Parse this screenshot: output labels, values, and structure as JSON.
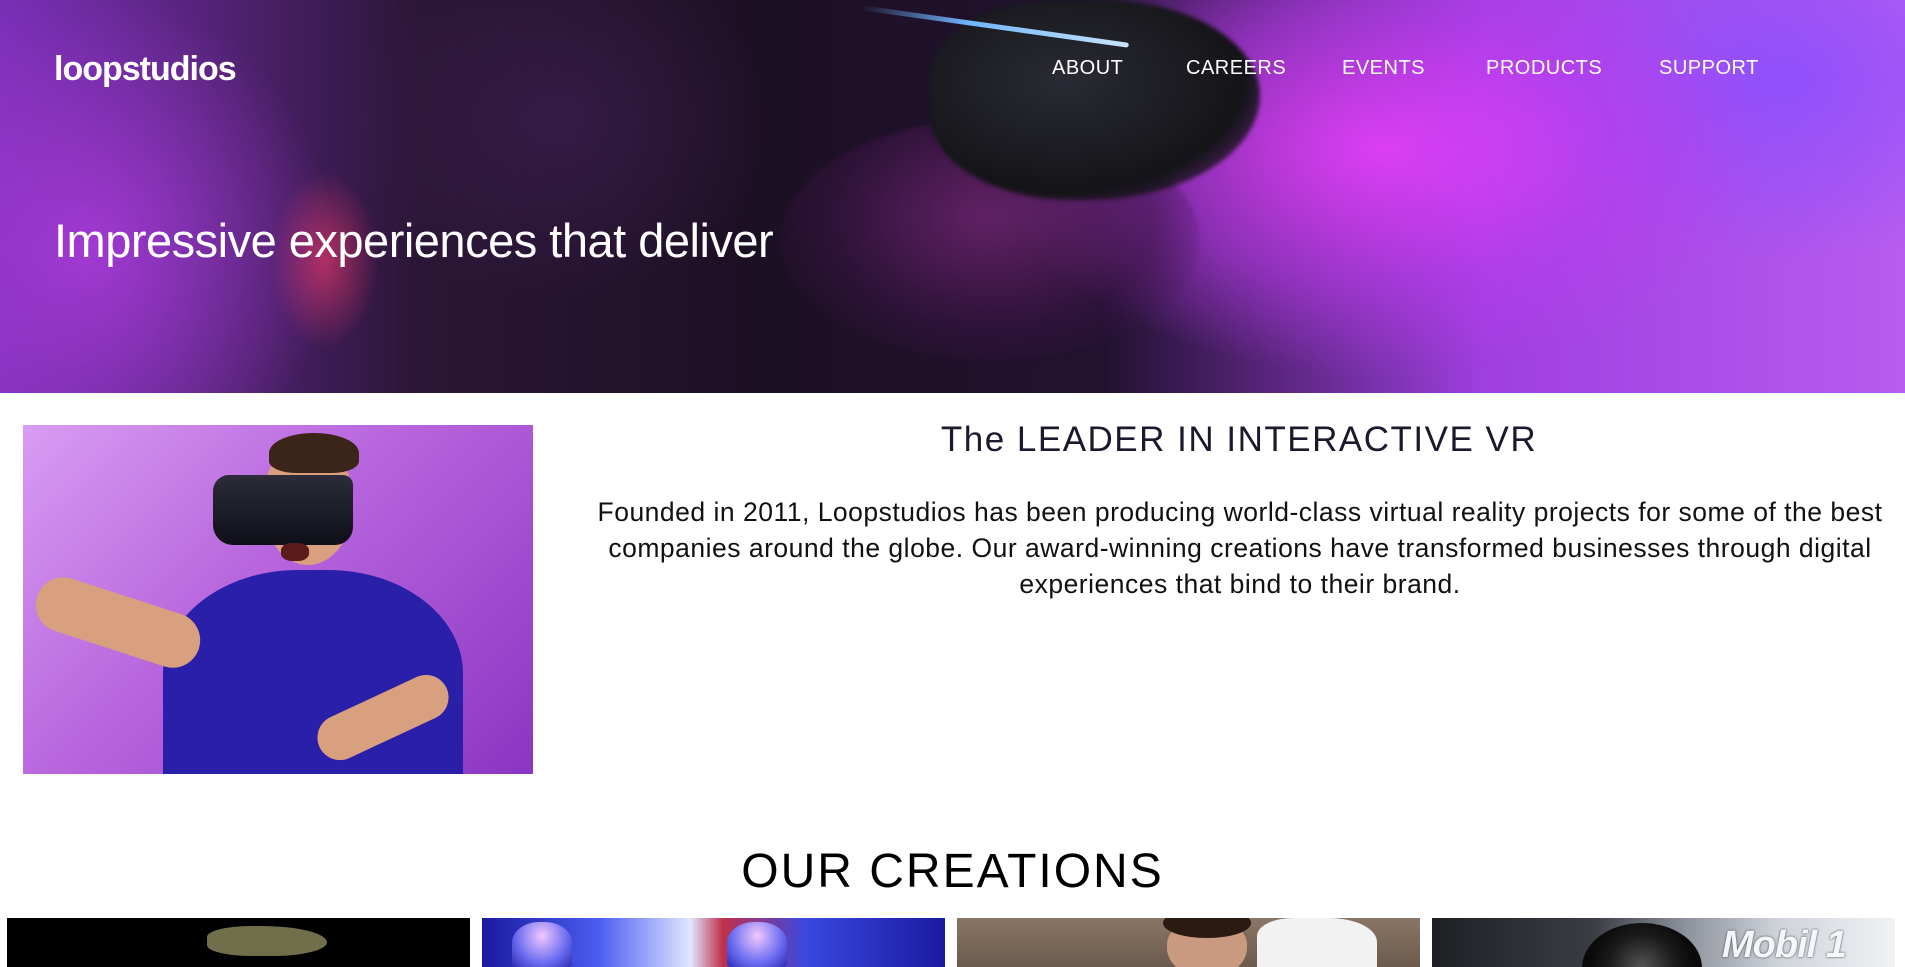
{
  "header": {
    "logo": "loopstudios",
    "nav": [
      {
        "label": "ABOUT"
      },
      {
        "label": "CAREERS"
      },
      {
        "label": "EVENTS"
      },
      {
        "label": "PRODUCTS"
      },
      {
        "label": "SUPPORT"
      }
    ]
  },
  "hero": {
    "headline": "Impressive experiences that deliver"
  },
  "intro": {
    "title": "The LEADER IN INTERACTIVE VR",
    "body": "Founded in 2011, Loopstudios has been producing world-class virtual reality projects for some of the best companies around the globe. Our award-winning creations have transformed businesses through digital experiences that bind to their brand."
  },
  "creations": {
    "title": "OUR CREATIONS",
    "cards": [
      {
        "subject": "earth"
      },
      {
        "subject": "arcade"
      },
      {
        "subject": "portrait"
      },
      {
        "subject": "racecar",
        "sponsor_text": "Mobil 1"
      }
    ]
  }
}
